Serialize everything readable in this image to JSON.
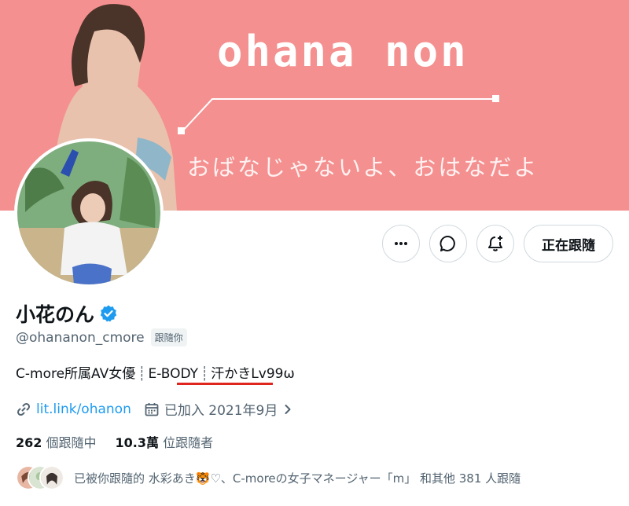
{
  "banner": {
    "title": "ohana non",
    "subtitle": "おばなじゃないよ、おはなだよ"
  },
  "actions": {
    "more_icon": "more-horizontal-icon",
    "message_icon": "message-icon",
    "notify_icon": "bell-plus-icon",
    "follow_label": "正在跟隨"
  },
  "profile": {
    "display_name": "小花のん",
    "verified": true,
    "handle": "@ohananon_cmore",
    "follows_you_badge": "跟隨你",
    "bio": {
      "part1": "C-more所属AV女優",
      "sep1": "┊",
      "part2": "E-BODY",
      "sep2": "┊",
      "part3": "汗かきLv99ω"
    },
    "link": "lit.link/ohanon",
    "joined": "已加入 2021年9月"
  },
  "stats": {
    "following_count": "262",
    "following_label": "個跟隨中",
    "followers_count": "10.3萬",
    "followers_label": "位跟隨者"
  },
  "followed_by": {
    "text": "已被你跟隨的 水彩あき🐯♡、C-moreの女子マネージャー「m」 和其他 381 人跟隨"
  },
  "colors": {
    "banner": "#f4908f",
    "link": "#1d9bf0",
    "verified": "#1d9bf0",
    "annotation": "#e0251f"
  }
}
